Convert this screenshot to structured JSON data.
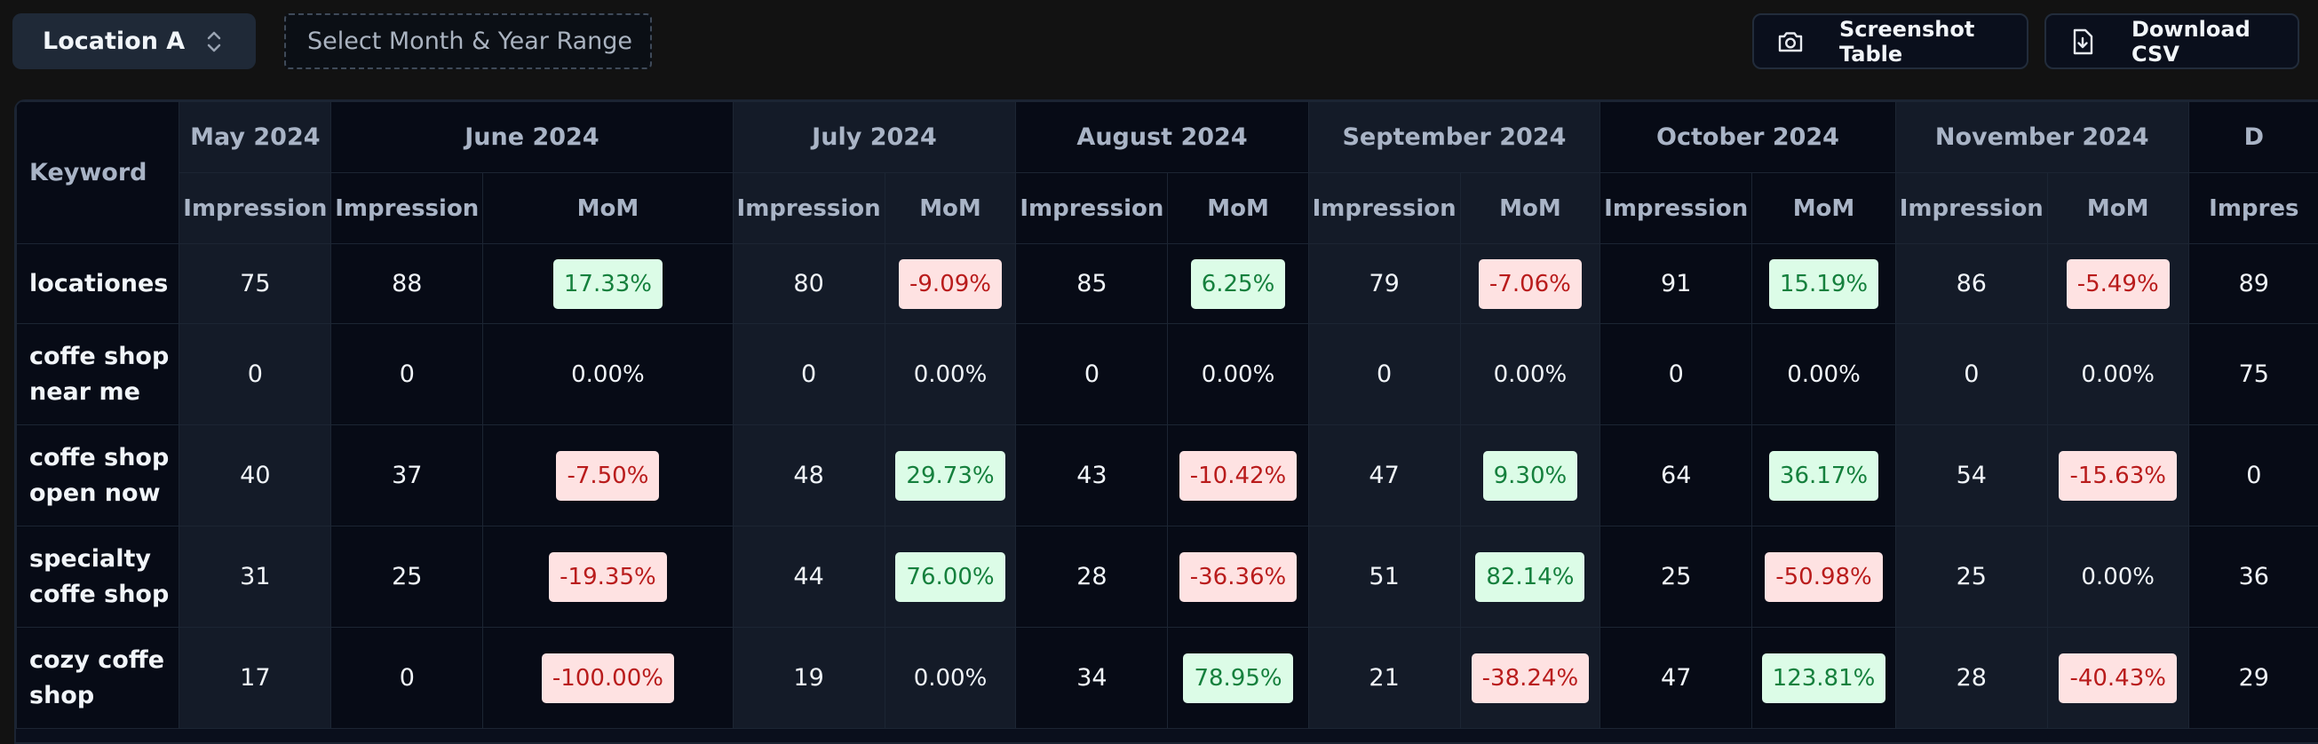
{
  "toolbar": {
    "location": "Location A",
    "range_placeholder": "Select Month & Year Range",
    "screenshot_label": "Screenshot Table",
    "download_label": "Download CSV"
  },
  "table": {
    "keyword_header": "Keyword",
    "first_month": "May 2024",
    "months": [
      "June 2024",
      "July 2024",
      "August 2024",
      "September 2024",
      "October 2024",
      "November 2024"
    ],
    "partial_month": "D",
    "impression_label": "Impression",
    "mom_label": "MoM",
    "partial_impression": "Impres",
    "rows": [
      {
        "keyword": "locationes",
        "first": "75",
        "cells": [
          {
            "imp": "88",
            "mom": "17.33%",
            "trend": "pos"
          },
          {
            "imp": "80",
            "mom": "-9.09%",
            "trend": "neg"
          },
          {
            "imp": "85",
            "mom": "6.25%",
            "trend": "pos"
          },
          {
            "imp": "79",
            "mom": "-7.06%",
            "trend": "neg"
          },
          {
            "imp": "91",
            "mom": "15.19%",
            "trend": "pos"
          },
          {
            "imp": "86",
            "mom": "-5.49%",
            "trend": "neg"
          }
        ],
        "partial": "89"
      },
      {
        "keyword": "coffe shop near me",
        "first": "0",
        "cells": [
          {
            "imp": "0",
            "mom": "0.00%",
            "trend": "neu"
          },
          {
            "imp": "0",
            "mom": "0.00%",
            "trend": "neu"
          },
          {
            "imp": "0",
            "mom": "0.00%",
            "trend": "neu"
          },
          {
            "imp": "0",
            "mom": "0.00%",
            "trend": "neu"
          },
          {
            "imp": "0",
            "mom": "0.00%",
            "trend": "neu"
          },
          {
            "imp": "0",
            "mom": "0.00%",
            "trend": "neu"
          }
        ],
        "partial": "75"
      },
      {
        "keyword": "coffe shop open now",
        "first": "40",
        "cells": [
          {
            "imp": "37",
            "mom": "-7.50%",
            "trend": "neg"
          },
          {
            "imp": "48",
            "mom": "29.73%",
            "trend": "pos"
          },
          {
            "imp": "43",
            "mom": "-10.42%",
            "trend": "neg"
          },
          {
            "imp": "47",
            "mom": "9.30%",
            "trend": "pos"
          },
          {
            "imp": "64",
            "mom": "36.17%",
            "trend": "pos"
          },
          {
            "imp": "54",
            "mom": "-15.63%",
            "trend": "neg"
          }
        ],
        "partial": "0"
      },
      {
        "keyword": "specialty coffe shop",
        "first": "31",
        "cells": [
          {
            "imp": "25",
            "mom": "-19.35%",
            "trend": "neg"
          },
          {
            "imp": "44",
            "mom": "76.00%",
            "trend": "pos"
          },
          {
            "imp": "28",
            "mom": "-36.36%",
            "trend": "neg"
          },
          {
            "imp": "51",
            "mom": "82.14%",
            "trend": "pos"
          },
          {
            "imp": "25",
            "mom": "-50.98%",
            "trend": "neg"
          },
          {
            "imp": "25",
            "mom": "0.00%",
            "trend": "neu"
          }
        ],
        "partial": "36"
      },
      {
        "keyword": "cozy coffe shop",
        "first": "17",
        "cells": [
          {
            "imp": "0",
            "mom": "-100.00%",
            "trend": "neg"
          },
          {
            "imp": "19",
            "mom": "0.00%",
            "trend": "neu"
          },
          {
            "imp": "34",
            "mom": "78.95%",
            "trend": "pos"
          },
          {
            "imp": "21",
            "mom": "-38.24%",
            "trend": "neg"
          },
          {
            "imp": "47",
            "mom": "123.81%",
            "trend": "pos"
          },
          {
            "imp": "28",
            "mom": "-40.43%",
            "trend": "neg"
          }
        ],
        "partial": "29"
      }
    ]
  }
}
